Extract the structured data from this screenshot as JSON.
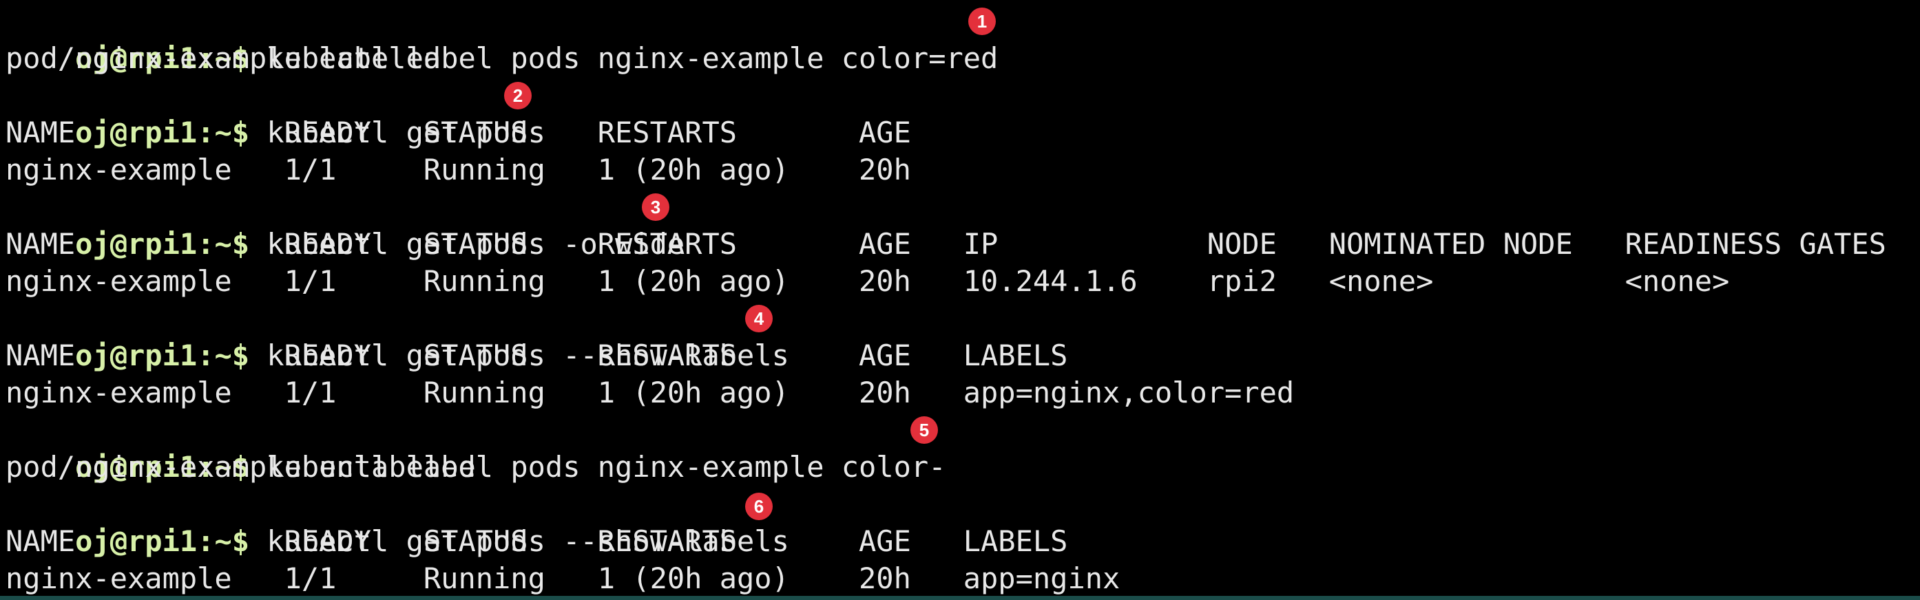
{
  "prompt": "oj@rpi1:~$",
  "commands": [
    {
      "text": "kubectl label pods nginx-example color=red",
      "badge": "1"
    },
    {
      "text": "kubectl get pods",
      "badge": "2"
    },
    {
      "text": "kubectl get pods -o wide",
      "badge": "3"
    },
    {
      "text": "kubectl get pods --show-labels",
      "badge": "4"
    },
    {
      "text": "kubectl label pods nginx-example color-",
      "badge": "5"
    },
    {
      "text": "kubectl get pods --show-labels",
      "badge": "6"
    }
  ],
  "outputs": {
    "labeled": "pod/nginx-example labeled",
    "get_header": "NAME            READY   STATUS    RESTARTS       AGE",
    "get_row": "nginx-example   1/1     Running   1 (20h ago)    20h",
    "wide_header": "NAME            READY   STATUS    RESTARTS       AGE   IP            NODE   NOMINATED NODE   READINESS GATES",
    "wide_row": "nginx-example   1/1     Running   1 (20h ago)    20h   10.244.1.6    rpi2   <none>           <none>",
    "labels_header": "NAME            READY   STATUS    RESTARTS       AGE   LABELS",
    "labels_row_1": "nginx-example   1/1     Running   1 (20h ago)    20h   app=nginx,color=red",
    "unlabeled": "pod/nginx-example unlabeled",
    "labels_row_2": "nginx-example   1/1     Running   1 (20h ago)    20h   app=nginx"
  },
  "colors": {
    "background": "#000000",
    "prompt": "#d7f0a8",
    "text": "#e8e8e8",
    "badge": "#e3303b",
    "bottom_border": "#1b4d4a"
  }
}
